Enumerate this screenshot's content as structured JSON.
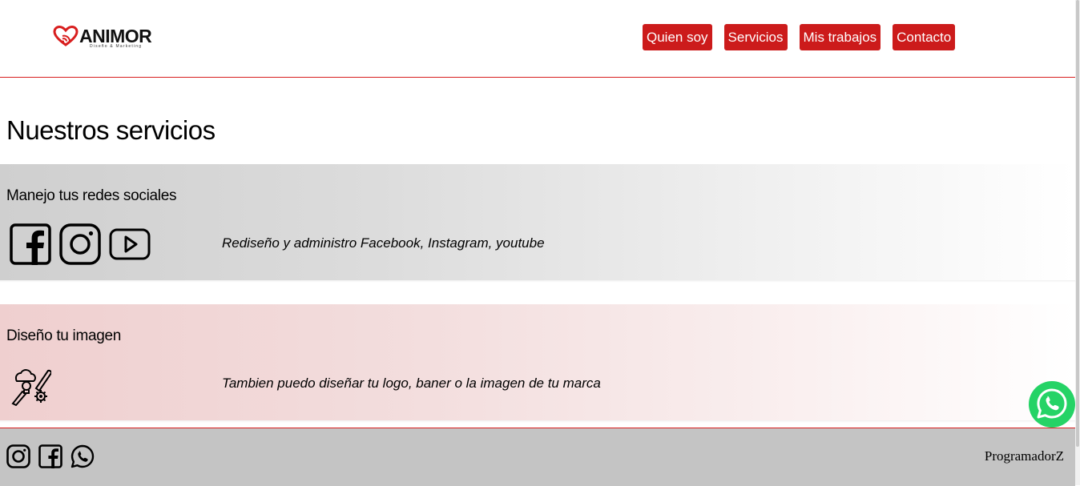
{
  "brand": {
    "name": "ANIMOR",
    "tagline": "Diseño & Marketing",
    "accent": "#cc1b1b"
  },
  "nav": {
    "items": [
      {
        "label": "Quien soy"
      },
      {
        "label": "Servicios"
      },
      {
        "label": "Mis trabajos"
      },
      {
        "label": "Contacto"
      }
    ]
  },
  "main": {
    "title": "Nuestros servicios",
    "services": [
      {
        "title": "Manejo tus redes sociales",
        "description": "Rediseño y administro Facebook, Instagram, youtube",
        "icons": [
          "facebook-icon",
          "instagram-icon",
          "youtube-icon"
        ]
      },
      {
        "title": "Diseño tu imagen",
        "description": "Tambien puedo diseñar tu logo, baner o la imagen de tu marca",
        "icons": [
          "design-tools-icon"
        ]
      }
    ]
  },
  "footer": {
    "icons": [
      "instagram-icon",
      "facebook-icon",
      "whatsapp-icon"
    ],
    "credit": "ProgramadorZ"
  },
  "floating": {
    "icon": "whatsapp-icon",
    "color": "#25d366"
  }
}
